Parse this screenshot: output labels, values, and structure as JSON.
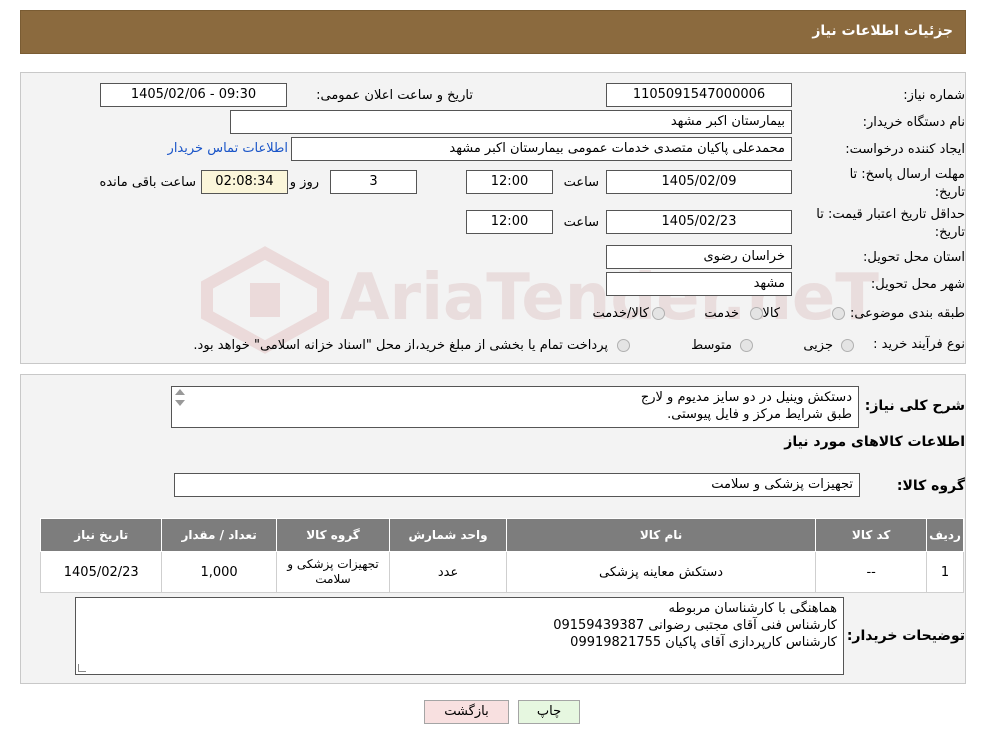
{
  "header": {
    "title": "جزئیات اطلاعات نیاز"
  },
  "watermark": {
    "text": "AriaTender.neT"
  },
  "form": {
    "need_number_label": "شماره نیاز:",
    "need_number": "1105091547000006",
    "announce_label": "تاریخ و ساعت اعلان عمومی:",
    "announce_value": "1405/02/06 - 09:30",
    "buyer_org_label": "نام دستگاه خریدار:",
    "buyer_org": "بیمارستان اکبر مشهد",
    "creator_label": "ایجاد کننده درخواست:",
    "creator": "محمدعلی پاکیان متصدی خدمات عمومی بیمارستان اکبر مشهد",
    "contact_link": "اطلاعات تماس خریدار",
    "deadline_label_1": "مهلت ارسال پاسخ: تا",
    "deadline_label_2": "تاریخ:",
    "deadline_date": "1405/02/09",
    "time_label": "ساعت",
    "deadline_time": "12:00",
    "days_value": "3",
    "days_label": "روز و",
    "remaining_time": "02:08:34",
    "remaining_label": "ساعت باقی مانده",
    "validity_label_1": "حداقل تاریخ اعتبار قیمت: تا",
    "validity_label_2": "تاریخ:",
    "validity_date": "1405/02/23",
    "validity_time": "12:00",
    "province_label": "استان محل تحویل:",
    "province": "خراسان رضوی",
    "city_label": "شهر محل تحویل:",
    "city": "مشهد",
    "category_label": "طبقه بندی موضوعی:",
    "category_options": [
      "کالا",
      "خدمت",
      "کالا/خدمت"
    ],
    "process_label": "نوع فرآیند خرید :",
    "process_options": [
      "جزیی",
      "متوسط"
    ],
    "process_note": "پرداخت تمام یا بخشی از مبلغ خرید،از محل \"اسناد خزانه اسلامی\" خواهد بود."
  },
  "details": {
    "summary_label": "شرح کلی نیاز:",
    "summary_line1": "دستکش وینیل در دو سایز مدیوم و لارج",
    "summary_line2": "طبق شرایط مرکز و فایل پیوستی.",
    "goods_info_title": "اطلاعات کالاهای مورد نیاز",
    "goods_group_label": "گروه کالا:",
    "goods_group": "تجهیزات پزشکی و سلامت",
    "table": {
      "headers": [
        "ردیف",
        "کد کالا",
        "نام کالا",
        "واحد شمارش",
        "گروه کالا",
        "تعداد / مقدار",
        "تاریخ نیاز"
      ],
      "rows": [
        [
          "1",
          "--",
          "دستکش معاینه پزشکی",
          "عدد",
          "تجهیزات پزشکی و سلامت",
          "1,000",
          "1405/02/23"
        ]
      ]
    },
    "buyer_notes_label": "توضیحات خریدار:",
    "buyer_notes_line1": "هماهنگی با کارشناسان مربوطه",
    "buyer_notes_line2": "کارشناس فنی آقای مجتبی رضوانی  09159439387",
    "buyer_notes_line3": "کارشناس کارپردازی آقای پاکیان 09919821755"
  },
  "buttons": {
    "print": "چاپ",
    "back": "بازگشت"
  },
  "colors": {
    "header": "#8b6a3e",
    "table_header": "#7d7d7d",
    "back_button": "#f8e0e0",
    "print_button": "#e6f7e0",
    "link": "#1a55c8"
  }
}
